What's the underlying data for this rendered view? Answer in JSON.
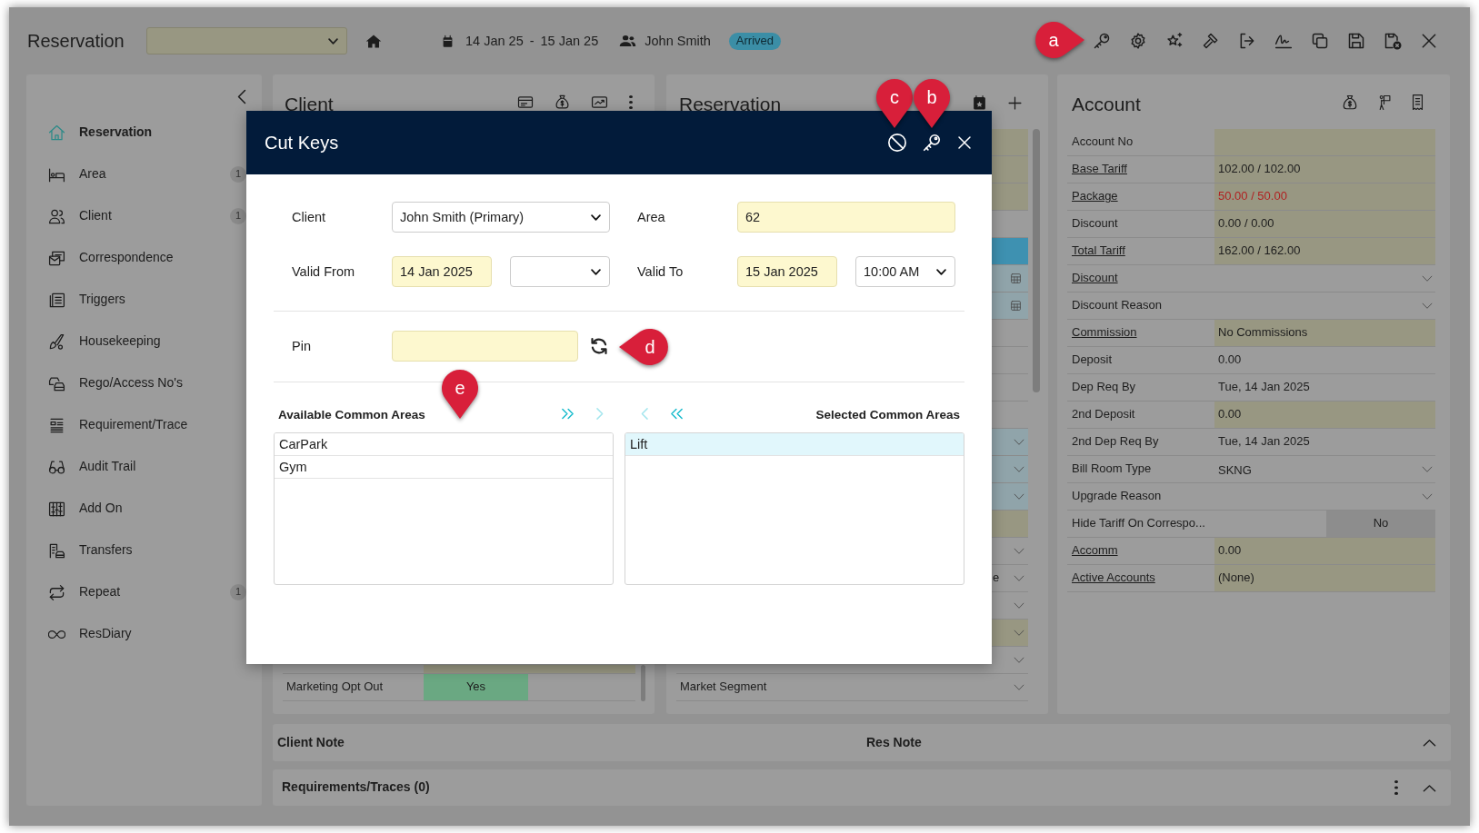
{
  "top_bar": {
    "title": "Reservation",
    "date_from": "14 Jan 25",
    "date_separator": "-",
    "date_to": "15 Jan 25",
    "guest": "John Smith",
    "status": "Arrived"
  },
  "sidebar": {
    "items": [
      {
        "label": "Reservation",
        "selected": true
      },
      {
        "label": "Area",
        "selected": false,
        "badge": "1"
      },
      {
        "label": "Client",
        "selected": false,
        "badge": "1"
      },
      {
        "label": "Correspondence",
        "selected": false
      },
      {
        "label": "Triggers",
        "selected": false
      },
      {
        "label": "Housekeeping",
        "selected": false
      },
      {
        "label": "Rego/Access No's",
        "selected": false
      },
      {
        "label": "Requirement/Trace",
        "selected": false
      },
      {
        "label": "Audit Trail",
        "selected": false
      },
      {
        "label": "Add On",
        "selected": false
      },
      {
        "label": "Transfers",
        "selected": false
      },
      {
        "label": "Repeat",
        "selected": false,
        "badge": "1"
      },
      {
        "label": "ResDiary",
        "selected": false
      }
    ]
  },
  "client_panel": {
    "title": "Client",
    "rows": [
      {
        "kind": "text",
        "color": "#989782"
      },
      {
        "kind": "toggle",
        "label": "Marketing Opt Out",
        "value": "Yes",
        "on": true
      }
    ]
  },
  "reservation_panel": {
    "title": "Reservation",
    "rows": [
      {
        "kind": "text",
        "color": "#989782"
      },
      {
        "kind": "text",
        "color": "#989782"
      },
      {
        "kind": "text",
        "color": "#989782"
      },
      {
        "kind": "text"
      },
      {
        "kind": "text",
        "color": "#3e91b1"
      },
      {
        "kind": "date",
        "color": "#90a4aa"
      },
      {
        "kind": "date",
        "color": "#90a4aa"
      },
      {
        "kind": "text"
      },
      {
        "kind": "text"
      },
      {
        "kind": "text"
      },
      {
        "kind": "text"
      },
      {
        "kind": "dropdown",
        "color": "#90a4aa"
      },
      {
        "kind": "dropdown",
        "color": "#90a4aa"
      },
      {
        "kind": "dropdown",
        "color": "#90a4aa"
      },
      {
        "kind": "text",
        "color": "#989782"
      },
      {
        "kind": "dropdown"
      },
      {
        "kind": "dropdown",
        "value": "e"
      },
      {
        "kind": "dropdown"
      },
      {
        "kind": "dropdown",
        "color": "#989782"
      },
      {
        "kind": "dropdown"
      },
      {
        "kind": "dropdown",
        "label": "Market Segment"
      }
    ]
  },
  "account_panel": {
    "title": "Account",
    "rows": [
      {
        "label": "Account No",
        "link": false,
        "kind": "text",
        "color": "#989782"
      },
      {
        "label": "Base Tariff",
        "link": true,
        "kind": "text",
        "value": "102.00 / 102.00",
        "alert": false,
        "color": "#989782"
      },
      {
        "label": "Package",
        "link": true,
        "kind": "text",
        "value": "50.00 / 50.00",
        "alert": true,
        "color": "#989782"
      },
      {
        "label": "Discount",
        "link": false,
        "kind": "text",
        "value": "0.00 / 0.00",
        "alert": false,
        "color": "#989782"
      },
      {
        "label": "Total Tariff",
        "link": true,
        "kind": "text",
        "value": "162.00 / 162.00",
        "alert": false,
        "color": "#989782"
      },
      {
        "label": "Discount",
        "link": true,
        "kind": "dropdown"
      },
      {
        "label": "Discount Reason",
        "link": false,
        "kind": "dropdown"
      },
      {
        "label": "Commission",
        "link": true,
        "kind": "text",
        "value": "No Commissions",
        "alert": false,
        "color": "#989782"
      },
      {
        "label": "Deposit",
        "link": false,
        "kind": "text",
        "value": "0.00",
        "alert": false
      },
      {
        "label": "Dep Req By",
        "link": false,
        "kind": "text",
        "value": "Tue, 14 Jan 2025",
        "alert": false
      },
      {
        "label": "2nd Deposit",
        "link": false,
        "kind": "text",
        "value": "0.00",
        "alert": false,
        "color": "#989782"
      },
      {
        "label": "2nd Dep Req By",
        "link": false,
        "kind": "text",
        "value": "Tue, 14 Jan 2025",
        "alert": false
      },
      {
        "label": "Bill Room Type",
        "link": false,
        "kind": "dropdown",
        "value": "SKNG"
      },
      {
        "label": "Upgrade Reason",
        "link": false,
        "kind": "dropdown"
      },
      {
        "label": "Hide Tariff On Correspo...",
        "link": false,
        "kind": "toggle",
        "value": "No",
        "on": false
      },
      {
        "label": "Accomm",
        "link": true,
        "kind": "text",
        "value": "0.00",
        "alert": false,
        "color": "#989782"
      },
      {
        "label": "Active Accounts",
        "link": true,
        "kind": "text",
        "value": "(None)",
        "alert": false,
        "color": "#989782"
      }
    ]
  },
  "notes_bar": {
    "client_note": "Client Note",
    "res_note": "Res Note"
  },
  "requirements_bar": {
    "title": "Requirements/Traces (0)"
  },
  "dialog": {
    "title": "Cut Keys",
    "client": {
      "label": "Client",
      "value": "John Smith (Primary)"
    },
    "area": {
      "label": "Area",
      "value": "62"
    },
    "valid_from": {
      "label": "Valid From",
      "date": "14 Jan 2025"
    },
    "valid_to": {
      "label": "Valid To",
      "date": "15 Jan 2025",
      "time": "10:00 AM"
    },
    "pin": {
      "label": "Pin"
    },
    "available_areas": {
      "title": "Available Common Areas",
      "items": [
        {
          "label": "CarPark",
          "selected": false
        },
        {
          "label": "Gym",
          "selected": false
        }
      ]
    },
    "transfer_buttons": [
      {
        "kind": "add-all",
        "disabled": false
      },
      {
        "kind": "add",
        "disabled": true
      },
      {
        "kind": "remove",
        "disabled": true
      },
      {
        "kind": "remove-all",
        "disabled": false
      }
    ],
    "selected_areas": {
      "title": "Selected Common Areas",
      "items": [
        {
          "label": "Lift",
          "selected": true
        }
      ]
    }
  },
  "callouts": [
    {
      "label": "a",
      "kind": "right"
    },
    {
      "label": "c",
      "kind": "down"
    },
    {
      "label": "b",
      "kind": "down"
    },
    {
      "label": "d",
      "kind": "left"
    },
    {
      "label": "e",
      "kind": "down"
    }
  ]
}
